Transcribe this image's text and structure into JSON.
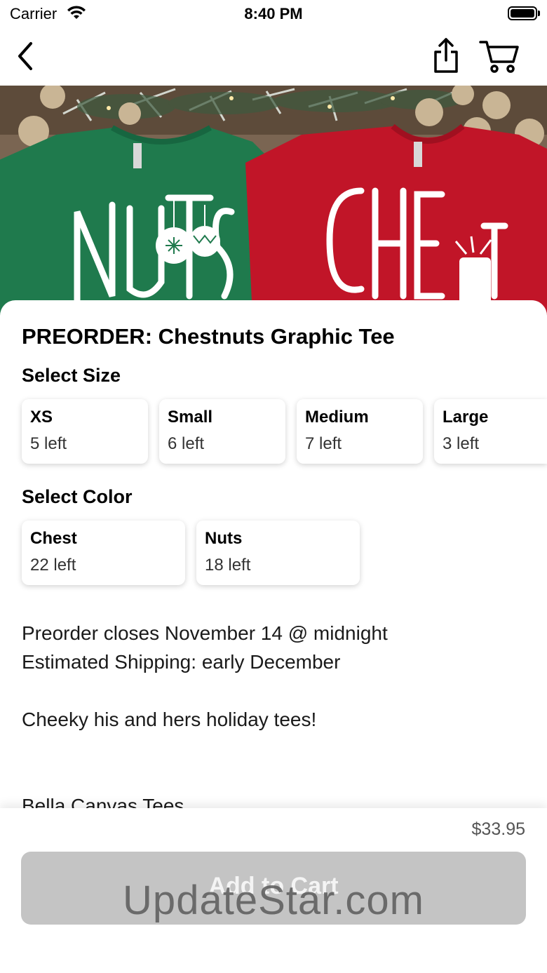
{
  "status_bar": {
    "carrier": "Carrier",
    "time": "8:40 PM"
  },
  "nav": {
    "back_icon": "chevron-left-icon",
    "share_icon": "share-icon",
    "cart_icon": "cart-icon"
  },
  "hero": {
    "left_shirt_text": "NUTS",
    "right_shirt_text": "CHEST",
    "left_shirt_color": "#1f7a4d",
    "right_shirt_color": "#c11528"
  },
  "product": {
    "title": "PREORDER: Chestnuts Graphic Tee",
    "size_label": "Select Size",
    "sizes": [
      {
        "name": "XS",
        "stock": "5 left"
      },
      {
        "name": "Small",
        "stock": "6 left"
      },
      {
        "name": "Medium",
        "stock": "7 left"
      },
      {
        "name": "Large",
        "stock": "3 left"
      }
    ],
    "color_label": "Select Color",
    "colors": [
      {
        "name": "Chest",
        "stock": "22 left"
      },
      {
        "name": "Nuts",
        "stock": "18 left"
      }
    ],
    "description": {
      "line1": "Preorder closes November 14 @ midnight",
      "line2": "Estimated Shipping: early December",
      "line3": "Cheeky his and hers holiday tees!",
      "line4": "Bella Canvas Tees"
    }
  },
  "footer": {
    "price": "$33.95",
    "add_to_cart": "Add to Cart",
    "button_color": "#c4c4c4"
  },
  "watermark": "UpdateStar.com"
}
